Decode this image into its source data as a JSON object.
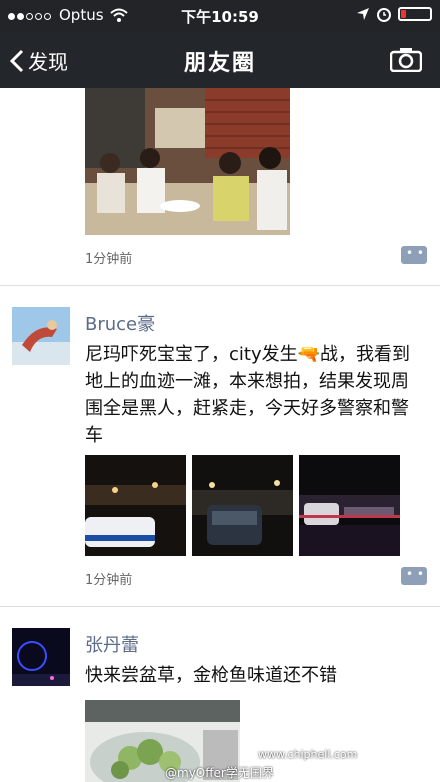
{
  "status_bar": {
    "carrier": "Optus",
    "time": "下午10:59"
  },
  "nav": {
    "back_label": "发现",
    "title": "朋友圈"
  },
  "posts": [
    {
      "time": "1分钟前"
    },
    {
      "name": "Bruce豪",
      "text": "尼玛吓死宝宝了，city发生🔫战，我看到地上的血迹一滩，本来想拍，结果发现周围全是黑人，赶紧走，今天好多警察和警车",
      "time": "1分钟前"
    },
    {
      "name": "张丹蕾",
      "text": "快来尝盆草，金枪鱼味道还不错"
    }
  ],
  "watermark": {
    "site": "www.chiphell.com",
    "credit": "@myOffer学无国界"
  },
  "colors": {
    "nav_bg": "#23272b",
    "name_color": "#5b6b8a"
  }
}
